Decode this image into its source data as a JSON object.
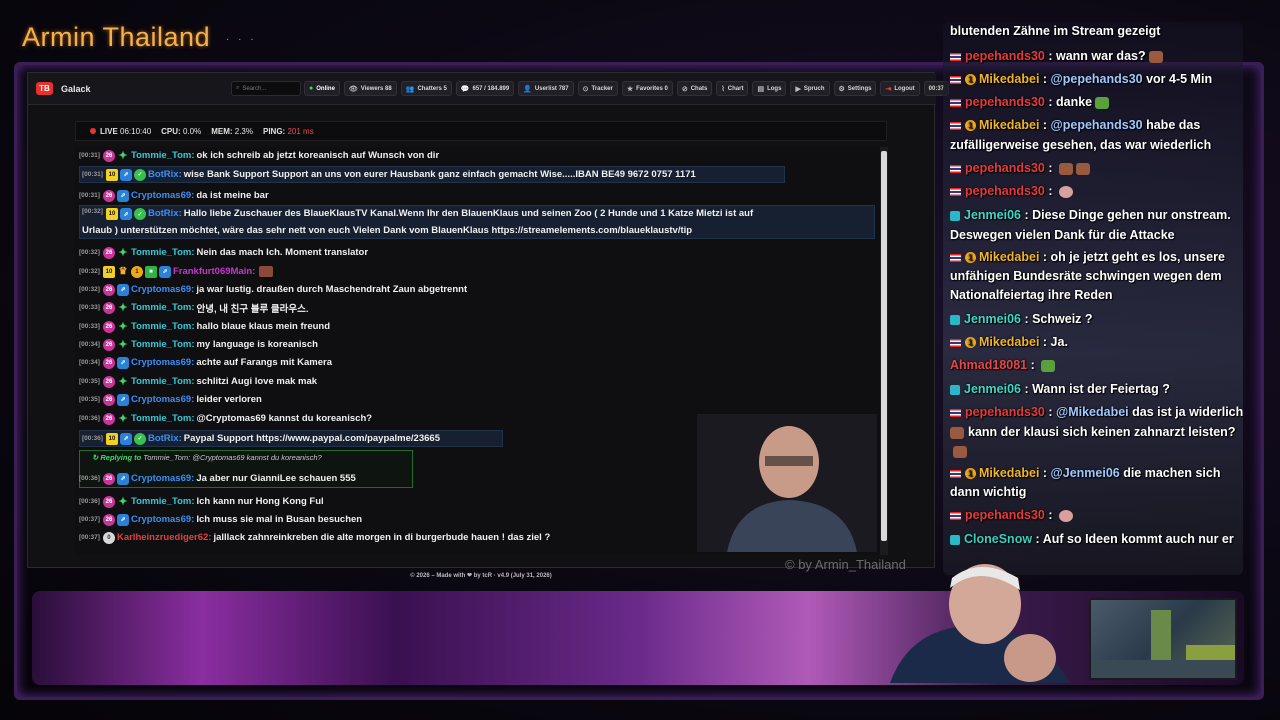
{
  "brand": {
    "title": "Armin Thailand",
    "dots": "· · ·"
  },
  "window": {
    "app_logo": "TB",
    "app_name": "Galack",
    "search_placeholder": "Search...",
    "nav": [
      {
        "icon": "●",
        "label": "Online"
      },
      {
        "icon": "👁",
        "label": "Viewers  88"
      },
      {
        "icon": "👥",
        "label": "Chatters  5"
      },
      {
        "icon": "💬",
        "label": "657 / 184.899"
      },
      {
        "icon": "👤",
        "label": "Userlist  787"
      },
      {
        "icon": "⊙",
        "label": "Tracker"
      },
      {
        "icon": "★",
        "label": "Favorites  0"
      },
      {
        "icon": "⊘",
        "label": "Chats"
      },
      {
        "icon": "⌇",
        "label": "Chart"
      },
      {
        "icon": "▤",
        "label": "Logs"
      },
      {
        "icon": "▶",
        "label": "Spruch"
      },
      {
        "icon": "⚙",
        "label": "Settings"
      },
      {
        "icon": "⇥",
        "label": "Logout"
      },
      {
        "icon": "",
        "label": "00:37"
      }
    ],
    "status": {
      "live_label": "LIVE",
      "live_time": "06:10:40",
      "cpu_label": "CPU:",
      "cpu": "0.0%",
      "mem_label": "MEM:",
      "mem": "2.3%",
      "ping_label": "PING:",
      "ping": "201 ms"
    },
    "messages": [
      {
        "ts": "[00:31]",
        "badges": [
          "sub",
          "star"
        ],
        "user": "Tommie_Tom:",
        "ucls": "u-tom",
        "text": "ok ich schreib ab jetzt koreanisch auf Wunsch von dir"
      },
      {
        "ts": "[00:31]",
        "badges": [
          "num",
          "mod",
          "ver"
        ],
        "user": "BotRix:",
        "ucls": "u-bot",
        "text": "wise Bank Support Support an uns von eurer Hausbank ganz einfach gemacht Wise.....IBAN BE49 9672 0757 1171",
        "hl": true
      },
      {
        "ts": "[00:31]",
        "badges": [
          "sub",
          "mod"
        ],
        "user": "Cryptomas69:",
        "ucls": "u-crypto",
        "text": "da ist meine bar"
      },
      {
        "ts": "[00:32]",
        "badges": [
          "num",
          "mod",
          "ver"
        ],
        "user": "BotRix:",
        "ucls": "u-bot",
        "text": "Hallo liebe Zuschauer des BlaueKlausTV Kanal.Wenn Ihr den BlauenKlaus und seinen Zoo ( 2 Hunde und 1 Katze Mietzi ist auf",
        "text2": "Urlaub ) unterstützen möchtet, wäre das sehr nett von euch Vielen Dank vom BlauenKlaus https://streamelements.com/blaueklaustv/tip",
        "hl": true
      },
      {
        "ts": "[00:32]",
        "badges": [
          "sub",
          "star"
        ],
        "user": "Tommie_Tom:",
        "ucls": "u-tom",
        "text": "Nein das mach Ich. Moment translator"
      },
      {
        "ts": "[00:32]",
        "badges": [
          "num",
          "crown",
          "gold",
          "green",
          "mod"
        ],
        "user": "Frankfurt069Main:",
        "ucls": "u-frank",
        "text": "",
        "emote": true
      },
      {
        "ts": "[00:32]",
        "badges": [
          "sub",
          "mod"
        ],
        "user": "Cryptomas69:",
        "ucls": "u-crypto",
        "text": "ja war lustig. draußen durch Maschendraht Zaun abgetrennt"
      },
      {
        "ts": "[00:33]",
        "badges": [
          "sub",
          "star"
        ],
        "user": "Tommie_Tom:",
        "ucls": "u-tom",
        "text": "안녕, 내 친구 블루 클라우스."
      },
      {
        "ts": "[00:33]",
        "badges": [
          "sub",
          "star"
        ],
        "user": "Tommie_Tom:",
        "ucls": "u-tom",
        "text": "hallo blaue klaus mein freund"
      },
      {
        "ts": "[00:34]",
        "badges": [
          "sub",
          "star"
        ],
        "user": "Tommie_Tom:",
        "ucls": "u-tom",
        "text": "my language is koreanisch"
      },
      {
        "ts": "[00:34]",
        "badges": [
          "sub",
          "mod"
        ],
        "user": "Cryptomas69:",
        "ucls": "u-crypto",
        "text": "achte auf Farangs mit Kamera"
      },
      {
        "ts": "[00:35]",
        "badges": [
          "sub",
          "star"
        ],
        "user": "Tommie_Tom:",
        "ucls": "u-tom",
        "text": "schlitzi Augi love mak mak"
      },
      {
        "ts": "[00:35]",
        "badges": [
          "sub",
          "mod"
        ],
        "user": "Cryptomas69:",
        "ucls": "u-crypto",
        "text": "leider verloren"
      },
      {
        "ts": "[00:36]",
        "badges": [
          "sub",
          "star"
        ],
        "user": "Tommie_Tom:",
        "ucls": "u-tom",
        "text": "@Cryptomas69 kannst du koreanisch?"
      },
      {
        "ts": "[00:36]",
        "badges": [
          "num",
          "mod",
          "ver"
        ],
        "user": "BotRix:",
        "ucls": "u-bot",
        "text": "Paypal Support https://www.paypal.com/paypalme/23665",
        "hl": true
      },
      {
        "ts": "[00:36]",
        "badges": [
          "sub",
          "mod"
        ],
        "user": "Cryptomas69:",
        "ucls": "u-crypto",
        "text": "Ja aber nur GianniLee schauen 555",
        "reply": true
      },
      {
        "ts": "[00:36]",
        "badges": [
          "sub",
          "star"
        ],
        "user": "Tommie_Tom:",
        "ucls": "u-tom",
        "text": "Ich kann nur Hong Kong Ful"
      },
      {
        "ts": "[00:37]",
        "badges": [
          "sub",
          "mod"
        ],
        "user": "Cryptomas69:",
        "ucls": "u-crypto",
        "text": "Ich muss sie mal in Busan besuchen"
      },
      {
        "ts": "[00:37]",
        "badges": [
          "grey"
        ],
        "user": "Karlheinzruediger62:",
        "ucls": "u-karl",
        "text": "jalllack zahnreinkreben die alte morgen in di burgerbude hauen ! das ziel ?"
      }
    ],
    "reply_prefix": "↻ Replying to",
    "reply_text": "Tommie_Tom: @Cryptomas69 kannst du koreanisch?",
    "badge_nums": {
      "num": "10",
      "sub": "26",
      "gold": "1",
      "grey": "0"
    },
    "watermark": "© by Armin_Thailand",
    "footer": "© 2026 – Made with ❤ by tcR · v4.9 (July 31, 2026)"
  },
  "right_chat": [
    {
      "flag": true,
      "user": "pepehands30",
      "ucls": "rn-pepe",
      "sep": " : ",
      "text": "wann war das?",
      "emote": "e"
    },
    {
      "flag": true,
      "ib": true,
      "user": "Mikedabei",
      "ucls": "rn-mike",
      "sep": " : ",
      "mention": "@pepehands30",
      "text": " vor 4-5 Min"
    },
    {
      "flag": true,
      "user": "pepehands30",
      "ucls": "rn-pepe",
      "sep": " : ",
      "text": "danke",
      "emote": "g"
    },
    {
      "flag": true,
      "ib": true,
      "user": "Mikedabei",
      "ucls": "rn-mike",
      "sep": " : ",
      "mention": "@pepehands30",
      "text": " habe das"
    },
    {
      "cont": true,
      "text": "zufälligerweise gesehen, das war wiederlich"
    },
    {
      "flag": true,
      "user": "pepehands30",
      "ucls": "rn-pepe",
      "sep": " : ",
      "text": "",
      "emote": "ee"
    },
    {
      "flag": true,
      "user": "pepehands30",
      "ucls": "rn-pepe",
      "sep": " : ",
      "text": "",
      "emote": "p"
    },
    {
      "cube": true,
      "user": "Jenmei06",
      "ucls": "rn-jen",
      "sep": " : ",
      "text": "Diese Dinge gehen nur onstream."
    },
    {
      "cont": true,
      "text": "Deswegen vielen Dank für die Attacke"
    },
    {
      "flag": true,
      "ib": true,
      "user": "Mikedabei",
      "ucls": "rn-mike",
      "sep": " : ",
      "text": "oh je jetzt geht es los, unsere"
    },
    {
      "cont": true,
      "text": "unfähigen Bundesräte schwingen wegen dem"
    },
    {
      "cont": true,
      "text": "Nationalfeiertag ihre Reden"
    },
    {
      "cube": true,
      "user": "Jenmei06",
      "ucls": "rn-jen",
      "sep": " : ",
      "text": "Schweiz ?"
    },
    {
      "flag": true,
      "ib": true,
      "user": "Mikedabei",
      "ucls": "rn-mike",
      "sep": " : ",
      "text": "Ja."
    },
    {
      "user": "Ahmad18081",
      "ucls": "rn-ahmad",
      "sep": " : ",
      "text": "",
      "emote": "g"
    },
    {
      "cube": true,
      "user": "Jenmei06",
      "ucls": "rn-jen",
      "sep": " : ",
      "text": "Wann ist der Feiertag ?"
    },
    {
      "flag": true,
      "user": "pepehands30",
      "ucls": "rn-pepe",
      "sep": " : ",
      "mention": "@Mikedabei",
      "text": " das ist ja widerlich"
    },
    {
      "cont": true,
      "emote_before": true,
      "text": "kann der klausi sich keinen zahnarzt leisten?"
    },
    {
      "cont": true,
      "text": "",
      "emote": "e"
    },
    {
      "flag": true,
      "ib": true,
      "user": "Mikedabei",
      "ucls": "rn-mike",
      "sep": " : ",
      "mention": "@Jenmei06",
      "text": " die machen sich"
    },
    {
      "cont": true,
      "text": "dann wichtig"
    },
    {
      "flag": true,
      "user": "pepehands30",
      "ucls": "rn-pepe",
      "sep": " : ",
      "text": "",
      "emote": "p"
    },
    {
      "cube": true,
      "user": "CloneSnow",
      "ucls": "rn-clone",
      "sep": " : ",
      "text": "Auf so Ideen kommt auch nur er"
    }
  ],
  "right_chat_top": "blutenden Zähne im Stream gezeigt",
  "colors": {
    "accent": "#f2b24a",
    "frame": "#3a1f55",
    "live": "#e83333",
    "online": "#3ddc6a"
  }
}
